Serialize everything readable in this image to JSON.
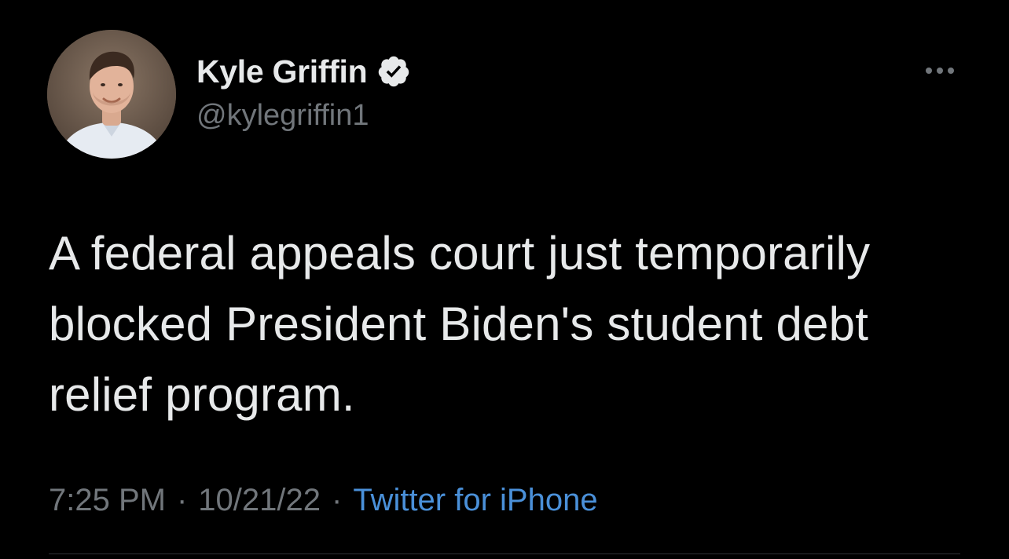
{
  "author": {
    "display_name": "Kyle Griffin",
    "handle": "@kylegriffin1",
    "verified": true
  },
  "tweet": {
    "text_lines": [
      "A federal appeals court just temporarily",
      "blocked President Biden's student debt",
      "relief program."
    ]
  },
  "meta": {
    "time": "7:25 PM",
    "separator": "·",
    "date": "10/21/22",
    "source": "Twitter for iPhone"
  },
  "icons": {
    "verified": "verified-badge-icon",
    "more": "more-horizontal-icon"
  },
  "colors": {
    "background": "#000000",
    "primary_text": "#e7e9ea",
    "secondary_text": "#71767b",
    "link": "#4a90d9",
    "divider": "#2f3336"
  }
}
